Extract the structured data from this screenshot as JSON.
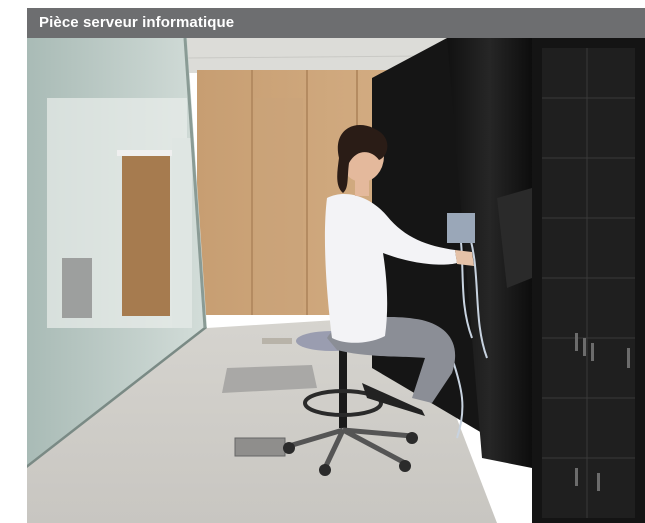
{
  "caption": {
    "title": "Pièce serveur informatique"
  },
  "photo": {
    "subject": "woman-at-server-rack",
    "colors": {
      "ceiling": "#d9d9d6",
      "wood_wall": "#c9a277",
      "floor": "#cfcdc8",
      "glass": "#b9c7c2",
      "rack": "#1a1a1a",
      "shirt": "#f4f4f6",
      "trousers": "#8c8f97",
      "hair": "#2a1c16",
      "stool": "#9b9eb0"
    }
  }
}
